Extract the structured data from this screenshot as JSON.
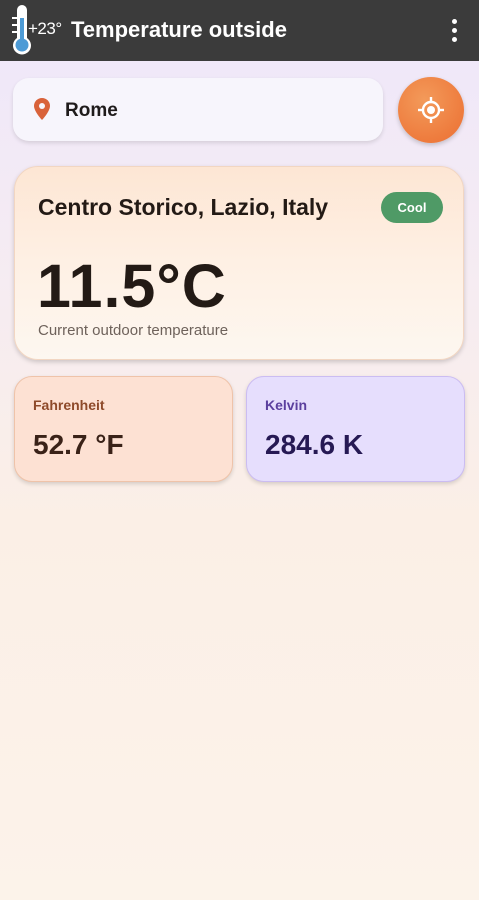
{
  "app": {
    "title": "Temperature outside",
    "icon_temperature": "+23°",
    "icon": "thermometer-icon",
    "menu_icon": "more-vert-icon"
  },
  "search": {
    "city": "Rome",
    "pin_icon": "location-pin-icon",
    "locate_icon": "my-location-icon"
  },
  "current": {
    "location": "Centro Storico, Lazio, Italy",
    "badge": "Cool",
    "temperature": "11.5°C",
    "caption": "Current outdoor temperature"
  },
  "fahrenheit": {
    "label": "Fahrenheit",
    "value": "52.7 °F"
  },
  "kelvin": {
    "label": "Kelvin",
    "value": "284.6 K"
  },
  "colors": {
    "appbar": "#3b3b3b",
    "accent_orange": "#ee7b3d",
    "badge_green": "#4f9a66",
    "fahrenheit_card": "#fde1d3",
    "kelvin_card": "#e6defd"
  }
}
